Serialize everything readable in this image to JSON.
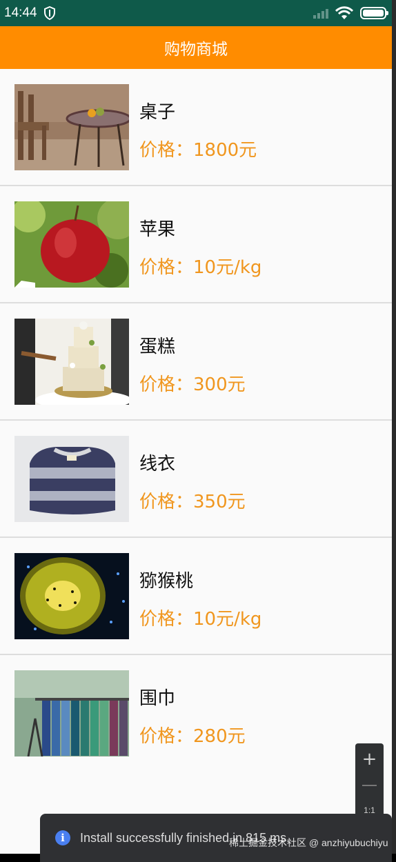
{
  "status_bar": {
    "time": "14:44"
  },
  "app_bar": {
    "title": "购物商城"
  },
  "products": [
    {
      "name": "桌子",
      "price": "价格：1800元",
      "image": "table-photo"
    },
    {
      "name": "苹果",
      "price": "价格：10元/kg",
      "image": "apple-photo"
    },
    {
      "name": "蛋糕",
      "price": "价格：300元",
      "image": "cake-photo"
    },
    {
      "name": "线衣",
      "price": "价格：350元",
      "image": "sweater-photo"
    },
    {
      "name": "猕猴桃",
      "price": "价格：10元/kg",
      "image": "kiwi-photo"
    },
    {
      "name": "围巾",
      "price": "价格：280元",
      "image": "scarf-photo"
    }
  ],
  "zoom_tool": {
    "plus": "+",
    "ratio": "1:1"
  },
  "toast": {
    "message": "Install successfully finished in 815 ms."
  },
  "watermark": "稀土掘金技术社区 @ anzhiyubuchiyu",
  "colors": {
    "app_bar": "#ff8c00",
    "price": "#f0961e",
    "status_bar": "#0f5a4a"
  }
}
